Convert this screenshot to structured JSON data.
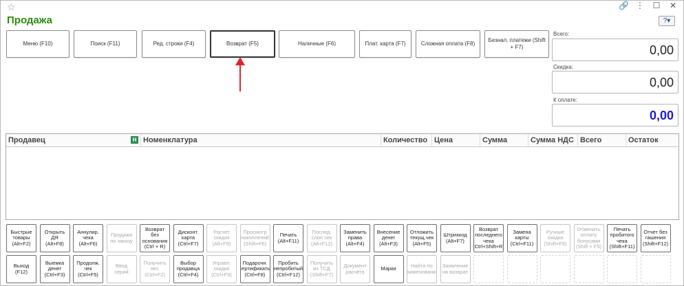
{
  "title": "Продажа",
  "window_icons": [
    "star-icon",
    "link-icon",
    "more-icon",
    "maximize-icon",
    "close-icon"
  ],
  "help_label": "?",
  "top_buttons": [
    {
      "label": "Меню (F10)"
    },
    {
      "label": "Поиск (F11)"
    },
    {
      "label": "Ред. строки (F4)"
    },
    {
      "label": "Возврат (F5)"
    },
    {
      "label": "Наличные (F6)"
    },
    {
      "label": "Плат. карта (F7)"
    },
    {
      "label": "Сложная оплата (F8)"
    },
    {
      "label": "Безнал. платежи (Shift + F7)"
    }
  ],
  "totals": {
    "total_label": "Всего:",
    "total_value": "0,00",
    "discount_label": "Скидка:",
    "discount_value": "0,00",
    "pay_label": "К оплате:",
    "pay_value": "0,00",
    "pay_color": "#1b1bd6"
  },
  "grid_columns": [
    "Продавец",
    "Номенклатура",
    "Количество",
    "Цена",
    "Сумма",
    "Сумма НДС",
    "Всего",
    "Остаток"
  ],
  "grid_icon_label": "Н",
  "row1_buttons": [
    {
      "label": "Быстрые товары (Alt+F2)",
      "enabled": true
    },
    {
      "label": "Открыть ДЯ (Alt+F8)",
      "enabled": true
    },
    {
      "label": "Аннулир. чека (Alt+F6)",
      "enabled": true
    },
    {
      "label": "Продажа по заказу",
      "enabled": false
    },
    {
      "label": "Возврат без основания (Ctrl + R)",
      "enabled": true
    },
    {
      "label": "Дисконт. карта (Ctrl+F7)",
      "enabled": true
    },
    {
      "label": "Расчет скидок (Alt+F9)",
      "enabled": false
    },
    {
      "label": "Просмотр накоплений (Shift+F6)",
      "enabled": false
    },
    {
      "label": "Печать (Alt+F11)",
      "enabled": true
    },
    {
      "label": "Послед. слип чек (Alt+F12)",
      "enabled": false
    },
    {
      "label": "Заменить права (Alt+F4)",
      "enabled": true
    },
    {
      "label": "Внесение денег (Alt+F3)",
      "enabled": true
    },
    {
      "label": "Отложить текущ.чек (Alt+F5)",
      "enabled": true
    },
    {
      "label": "Штрихкод (Alt+F7)",
      "enabled": true
    },
    {
      "label": "Возврат последнего чека (Ctrl+Shift+R)",
      "enabled": true
    },
    {
      "label": "Замена карты (Ctrl+F11)",
      "enabled": true
    },
    {
      "label": "Ручные скидки (Shift+F8)",
      "enabled": false
    },
    {
      "label": "Отменить оплату бонусами (Shift + F5)",
      "enabled": false
    },
    {
      "label": "Печать пробитого чека (Shift+F11)",
      "enabled": true
    },
    {
      "label": "Отчет без гашения (Shift+F12)",
      "enabled": true
    }
  ],
  "row2_buttons": [
    {
      "label": "Выход (F12)",
      "enabled": true
    },
    {
      "label": "Выемка денег (Ctrl+F3)",
      "enabled": true
    },
    {
      "label": "Продолж. чек (Ctrl+F5)",
      "enabled": true
    },
    {
      "label": "Ввод серий",
      "enabled": false
    },
    {
      "label": "Получить вес (Ctrl+F2)",
      "enabled": false
    },
    {
      "label": "Выбор продавца (Ctrl+F4)",
      "enabled": true
    },
    {
      "label": "Управл. скидки (Ctrl+F9)",
      "enabled": false
    },
    {
      "label": "Подарочн. сертификаты (Ctrl+F8)",
      "enabled": true
    },
    {
      "label": "Пробить непробитый (Ctrl+F12)",
      "enabled": true
    },
    {
      "label": "Получить из ТСД (Shift+F7)",
      "enabled": false
    },
    {
      "label": "Документ расчета",
      "enabled": false
    },
    {
      "label": "Марки",
      "enabled": true
    },
    {
      "label": "Найти по наименованию",
      "enabled": false
    },
    {
      "label": "Заявление на возврат",
      "enabled": false
    }
  ]
}
